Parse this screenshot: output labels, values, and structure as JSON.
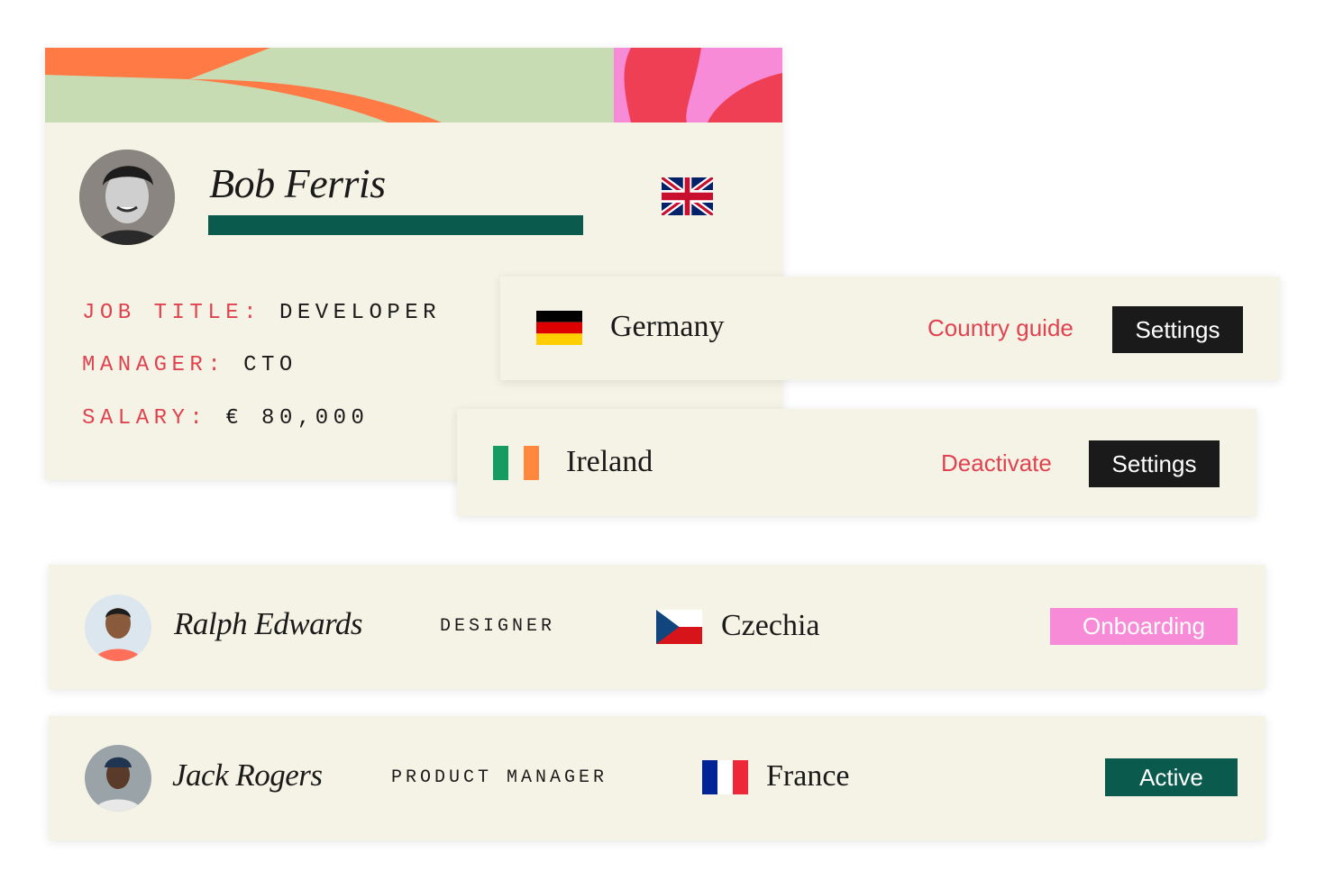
{
  "profile": {
    "name": "Bob Ferris",
    "flag_icon": "uk-flag-icon",
    "fields": [
      {
        "label": "JOB TITLE:",
        "value": "DEVELOPER"
      },
      {
        "label": "MANAGER:",
        "value": "CTO"
      },
      {
        "label": "SALARY:",
        "value": "€ 80,000"
      }
    ]
  },
  "countries": [
    {
      "name": "Germany",
      "flag_icon": "germany-flag-icon",
      "link": "Country guide",
      "button": "Settings"
    },
    {
      "name": "Ireland",
      "flag_icon": "ireland-flag-icon",
      "link": "Deactivate",
      "button": "Settings"
    }
  ],
  "employees": [
    {
      "name": "Ralph Edwards",
      "role": "DESIGNER",
      "country": "Czechia",
      "flag_icon": "czechia-flag-icon",
      "status": "Onboarding",
      "status_color": "#f78bd8"
    },
    {
      "name": "Jack Rogers",
      "role": "PRODUCT MANAGER",
      "country": "France",
      "flag_icon": "france-flag-icon",
      "status": "Active",
      "status_color": "#0b5a4e"
    }
  ],
  "colors": {
    "card_bg": "#f5f3e5",
    "accent_red": "#e0434f",
    "dark_green": "#0b5a4e",
    "pink": "#f78bd8",
    "orange": "#ff7a45",
    "sage": "#c8dcb3"
  }
}
